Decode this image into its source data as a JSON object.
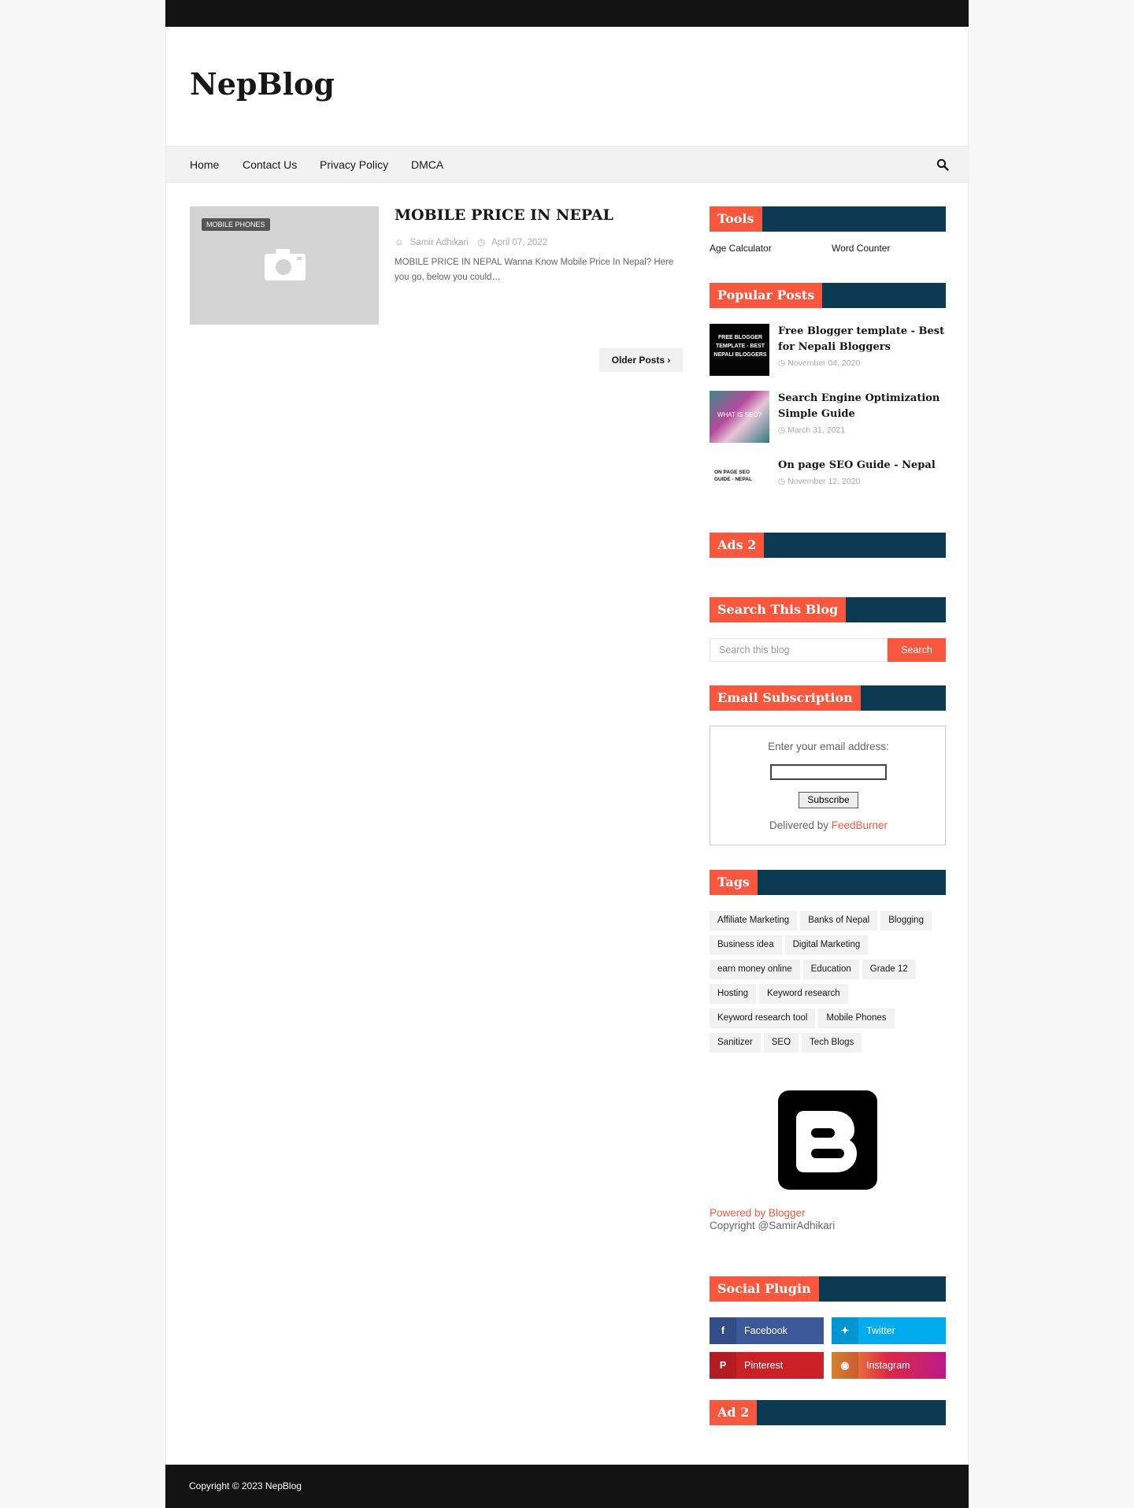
{
  "site": {
    "logo": "NepBlog"
  },
  "nav": {
    "items": [
      "Home",
      "Contact Us",
      "Privacy Policy",
      "DMCA"
    ]
  },
  "post": {
    "label": "MOBILE PHONES",
    "title": "MOBILE PRICE IN NEPAL",
    "author": "Samir Adhikari",
    "date": "April 07, 2022",
    "snippet": "MOBILE PRICE IN NEPAL Wanna Know Mobile Price In Nepal? Here you go, below you could…"
  },
  "pagination": {
    "older": "Older Posts"
  },
  "tools": {
    "title": "Tools",
    "links": [
      "Age Calculator",
      "Word Counter"
    ]
  },
  "popular": {
    "title": "Popular Posts",
    "items": [
      {
        "title": "Free Blogger template - Best for Nepali Bloggers",
        "date": "November 04, 2020",
        "thumb_text": "FREE BLOGGER TEMPLATE - BEST NEPALI BLOGGERS"
      },
      {
        "title": "Search Engine Optimization Simple Guide",
        "date": "March 31, 2021",
        "thumb_text": "WHAT IS SEO?"
      },
      {
        "title": "On page SEO Guide - Nepal",
        "date": "November 12, 2020",
        "thumb_text": "ON PAGE SEO GUIDE - NEPAL"
      }
    ]
  },
  "ads2": {
    "title": "Ads 2"
  },
  "searchblog": {
    "title": "Search This Blog",
    "placeholder": "Search this blog",
    "button": "Search"
  },
  "email": {
    "title": "Email Subscription",
    "label": "Enter your email address:",
    "button": "Subscribe",
    "delivered": "Delivered by ",
    "feedburner": "FeedBurner"
  },
  "tags": {
    "title": "Tags",
    "items": [
      "Affiliate Marketing",
      "Banks of Nepal",
      "Blogging",
      "Business idea",
      "Digital Marketing",
      "earn money online",
      "Education",
      "Grade 12",
      "Hosting",
      "Keyword research",
      "Keyword research tool",
      "Mobile Phones",
      "Sanitizer",
      "SEO",
      "Tech Blogs"
    ]
  },
  "attribution": {
    "powered": "Powered by Blogger",
    "copyright": "Copyright @SamirAdhikari"
  },
  "social": {
    "title": "Social Plugin",
    "items": [
      {
        "label": "Facebook",
        "color": "#3b5999",
        "icon": "facebook-icon"
      },
      {
        "label": "Twitter",
        "color": "#00acee",
        "icon": "twitter-icon"
      },
      {
        "label": "Pinterest",
        "color": "#ca2127",
        "icon": "pinterest-icon"
      },
      {
        "label": "Instagram",
        "color": "#e1306c",
        "icon": "instagram-icon"
      }
    ]
  },
  "ad2": {
    "title": "Ad 2"
  },
  "footer": {
    "copyright": "Copyright © 2023 NepBlog"
  },
  "colors": {
    "accent": "#f9573d",
    "widget_bar": "#0b3a52",
    "topbar": "#131313"
  }
}
